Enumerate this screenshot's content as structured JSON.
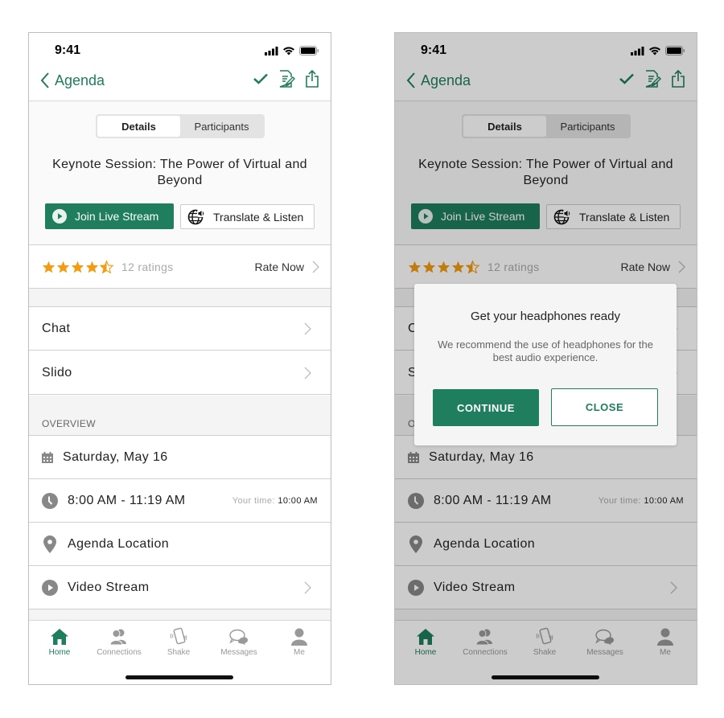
{
  "colors": {
    "accent": "#1e7e5e",
    "star": "#f39c12",
    "overlay": "rgba(0,0,0,0.2)"
  },
  "status_bar": {
    "time": "9:41"
  },
  "nav": {
    "back_label": "Agenda",
    "icons": [
      "check-icon",
      "notes-icon",
      "share-icon"
    ]
  },
  "segmented": {
    "tabs": [
      {
        "label": "Details",
        "active": true
      },
      {
        "label": "Participants",
        "active": false
      }
    ]
  },
  "session": {
    "title": "Keynote Session: The Power of Virtual and Beyond",
    "join_label": "Join Live Stream",
    "translate_label": "Translate & Listen"
  },
  "rating": {
    "value": 4.5,
    "max": 5,
    "count_label": "12 ratings",
    "rate_now_label": "Rate Now"
  },
  "links": [
    {
      "label": "Chat"
    },
    {
      "label": "Slido"
    }
  ],
  "overview": {
    "header": "OVERVIEW",
    "date": "Saturday, May 16",
    "time_range": "8:00 AM - 11:19 AM",
    "your_time_label": "Your time:",
    "your_time_value": "10:00 AM",
    "location": "Agenda Location",
    "video": "Video Stream"
  },
  "tabbar": {
    "items": [
      {
        "label": "Home",
        "icon": "home-icon",
        "active": true
      },
      {
        "label": "Connections",
        "icon": "connections-icon",
        "active": false
      },
      {
        "label": "Shake",
        "icon": "shake-icon",
        "active": false
      },
      {
        "label": "Messages",
        "icon": "messages-icon",
        "active": false
      },
      {
        "label": "Me",
        "icon": "profile-icon",
        "active": false
      }
    ]
  },
  "dialog": {
    "title": "Get your headphones ready",
    "body": "We recommend the use of headphones for the best audio experience.",
    "continue_label": "CONTINUE",
    "close_label": "CLOSE"
  }
}
